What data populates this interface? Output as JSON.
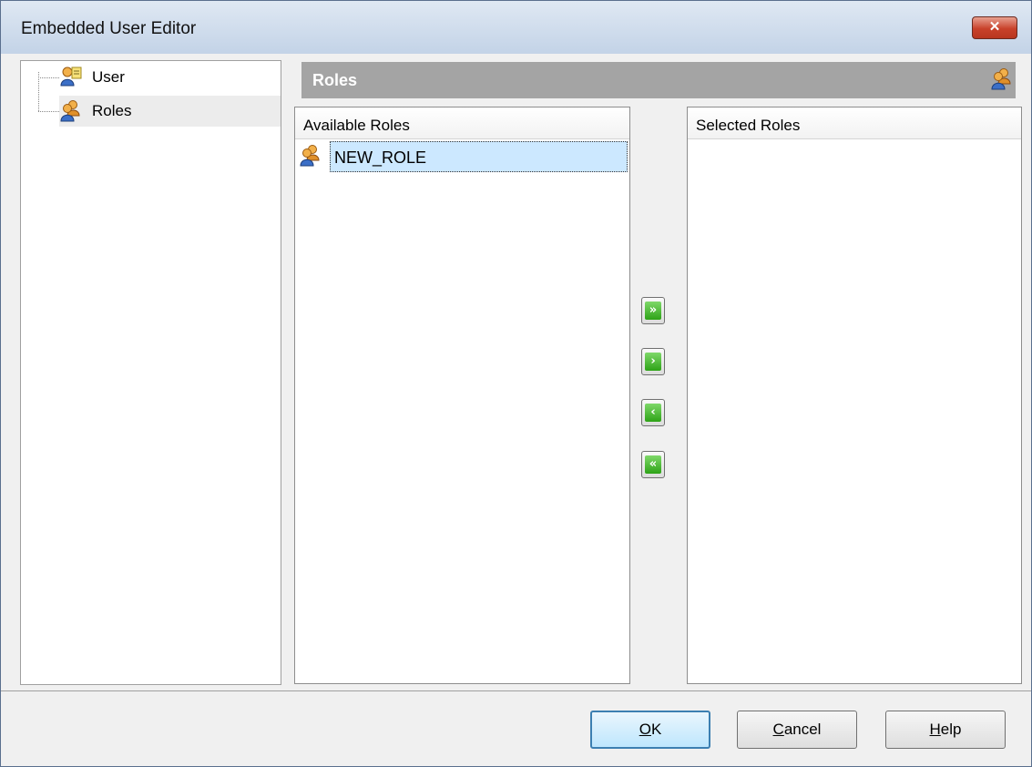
{
  "window": {
    "title": "Embedded User Editor",
    "close_glyph": "✕"
  },
  "tree": {
    "items": [
      {
        "label": "User",
        "icon": "user-icon",
        "selected": false
      },
      {
        "label": "Roles",
        "icon": "roles-icon",
        "selected": true
      }
    ]
  },
  "header": {
    "title": "Roles",
    "icon": "roles-icon"
  },
  "available": {
    "header": "Available Roles",
    "rows": [
      {
        "name": "NEW_ROLE",
        "icon": "role-icon",
        "selected": true
      }
    ]
  },
  "selected": {
    "header": "Selected Roles",
    "rows": []
  },
  "move_buttons": [
    {
      "name": "add-all-button",
      "glyph": "»"
    },
    {
      "name": "add-button",
      "glyph": "›"
    },
    {
      "name": "remove-button",
      "glyph": "‹"
    },
    {
      "name": "remove-all-button",
      "glyph": "«"
    }
  ],
  "buttons": {
    "ok": {
      "label": "OK",
      "mnemonic": "O",
      "rest": "K"
    },
    "cancel": {
      "label": "Cancel",
      "mnemonic": "C",
      "rest": "ancel"
    },
    "help": {
      "label": "Help",
      "mnemonic": "H",
      "rest": "elp"
    }
  },
  "colors": {
    "title_bar": "#c3d3e7",
    "header_bar": "#a4a4a4",
    "selection": "#cce8ff",
    "move_button_green": "#2ea317",
    "close_button": "#c8412a"
  }
}
